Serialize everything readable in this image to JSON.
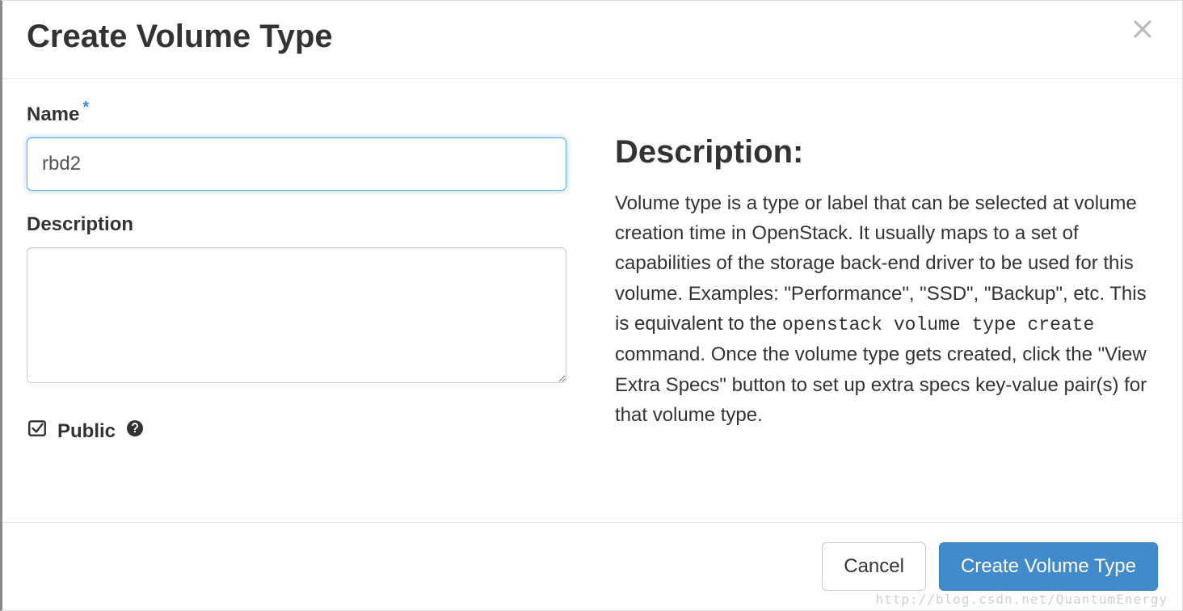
{
  "modal": {
    "title": "Create Volume Type"
  },
  "form": {
    "name_label": "Name",
    "name_value": "rbd2",
    "description_label": "Description",
    "description_value": "",
    "public_label": "Public",
    "public_checked": true
  },
  "help": {
    "heading": "Description:",
    "text_part1": "Volume type is a type or label that can be selected at volume creation time in OpenStack. It usually maps to a set of capabilities of the storage back-end driver to be used for this volume. Examples: \"Performance\", \"SSD\", \"Backup\", etc. This is equivalent to the ",
    "code": "openstack volume type create",
    "text_part2": " command. Once the volume type gets created, click the \"View Extra Specs\" button to set up extra specs key-value pair(s) for that volume type."
  },
  "footer": {
    "cancel_label": "Cancel",
    "submit_label": "Create Volume Type"
  },
  "watermark": "http://blog.csdn.net/QuantumEnergy"
}
